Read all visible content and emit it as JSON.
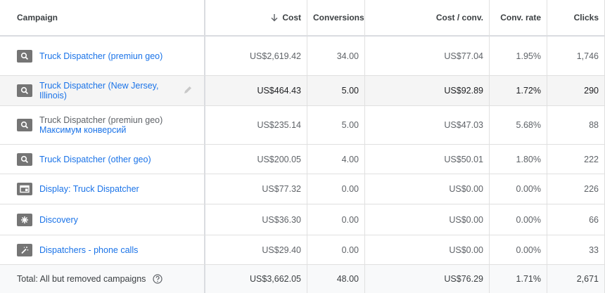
{
  "headers": {
    "campaign": "Campaign",
    "cost": "Cost",
    "conversions": "Conversions",
    "cost_per_conv": "Cost / conv.",
    "conv_rate": "Conv. rate",
    "clicks": "Clicks"
  },
  "rows": [
    {
      "icon": "search-icon",
      "name": "Truck Dispatcher (premiun geo)",
      "sub": "",
      "cost": "US$2,619.42",
      "conversions": "34.00",
      "cost_per_conv": "US$77.04",
      "conv_rate": "1.95%",
      "clicks": "1,746"
    },
    {
      "icon": "search-icon",
      "name": "Truck Dispatcher (New Jersey, Illinois)",
      "sub": "",
      "cost": "US$464.43",
      "conversions": "5.00",
      "cost_per_conv": "US$92.89",
      "conv_rate": "1.72%",
      "clicks": "290"
    },
    {
      "icon": "search-icon",
      "name": "Truck Dispatcher (premiun geo)",
      "sub": "Максимум конверсий",
      "cost": "US$235.14",
      "conversions": "5.00",
      "cost_per_conv": "US$47.03",
      "conv_rate": "5.68%",
      "clicks": "88"
    },
    {
      "icon": "search-icon",
      "name": "Truck Dispatcher (other geo)",
      "sub": "",
      "cost": "US$200.05",
      "conversions": "4.00",
      "cost_per_conv": "US$50.01",
      "conv_rate": "1.80%",
      "clicks": "222"
    },
    {
      "icon": "display-icon",
      "name": "Display: Truck Dispatcher",
      "sub": "",
      "cost": "US$77.32",
      "conversions": "0.00",
      "cost_per_conv": "US$0.00",
      "conv_rate": "0.00%",
      "clicks": "226"
    },
    {
      "icon": "discovery-icon",
      "name": "Discovery",
      "sub": "",
      "cost": "US$36.30",
      "conversions": "0.00",
      "cost_per_conv": "US$0.00",
      "conv_rate": "0.00%",
      "clicks": "66"
    },
    {
      "icon": "magic-wand-icon",
      "name": "Dispatchers - phone calls",
      "sub": "",
      "cost": "US$29.40",
      "conversions": "0.00",
      "cost_per_conv": "US$0.00",
      "conv_rate": "0.00%",
      "clicks": "33"
    }
  ],
  "total": {
    "label": "Total: All but removed campaigns",
    "cost": "US$3,662.05",
    "conversions": "48.00",
    "cost_per_conv": "US$76.29",
    "conv_rate": "1.71%",
    "clicks": "2,671"
  }
}
